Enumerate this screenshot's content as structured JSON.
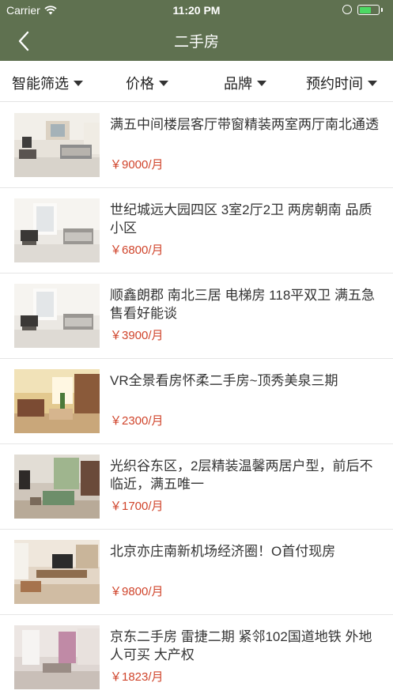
{
  "status_bar": {
    "carrier": "Carrier",
    "time": "11:20 PM"
  },
  "nav": {
    "title": "二手房",
    "back_icon": "chevron-left-icon"
  },
  "filters": [
    {
      "label": "智能筛选"
    },
    {
      "label": "价格"
    },
    {
      "label": "品牌"
    },
    {
      "label": "预约时间"
    }
  ],
  "colors": {
    "header_bg": "#5f7150",
    "price": "#d0452c",
    "battery": "#4cd964"
  },
  "listings": [
    {
      "title": "满五中间楼层客厅带窗精装两室两厅南北通透",
      "price": "￥9000/月",
      "photo": "living-room-photo"
    },
    {
      "title": "世纪城远大园四区 3室2厅2卫 两房朝南 品质小区",
      "price": "￥6800/月",
      "photo": "living-room-photo"
    },
    {
      "title": "顺鑫朗郡 南北三居 电梯房 118平双卫 满五急售看好能谈",
      "price": "￥3900/月",
      "photo": "living-room-photo"
    },
    {
      "title": "VR全景看房怀柔二手房~顶秀美泉三期",
      "price": "￥2300/月",
      "photo": "living-room-photo"
    },
    {
      "title": "光织谷东区，2层精装温馨两居户型，前后不临近，满五唯一",
      "price": "￥1700/月",
      "photo": "living-room-photo"
    },
    {
      "title": "北京亦庄南新机场经济圈！O首付现房",
      "price": "￥9800/月",
      "photo": "living-room-photo"
    },
    {
      "title": "京东二手房 雷捷二期 紧邻102国道地铁 外地人可买 大产权",
      "price": "￥1823/月",
      "photo": "living-room-photo"
    }
  ]
}
